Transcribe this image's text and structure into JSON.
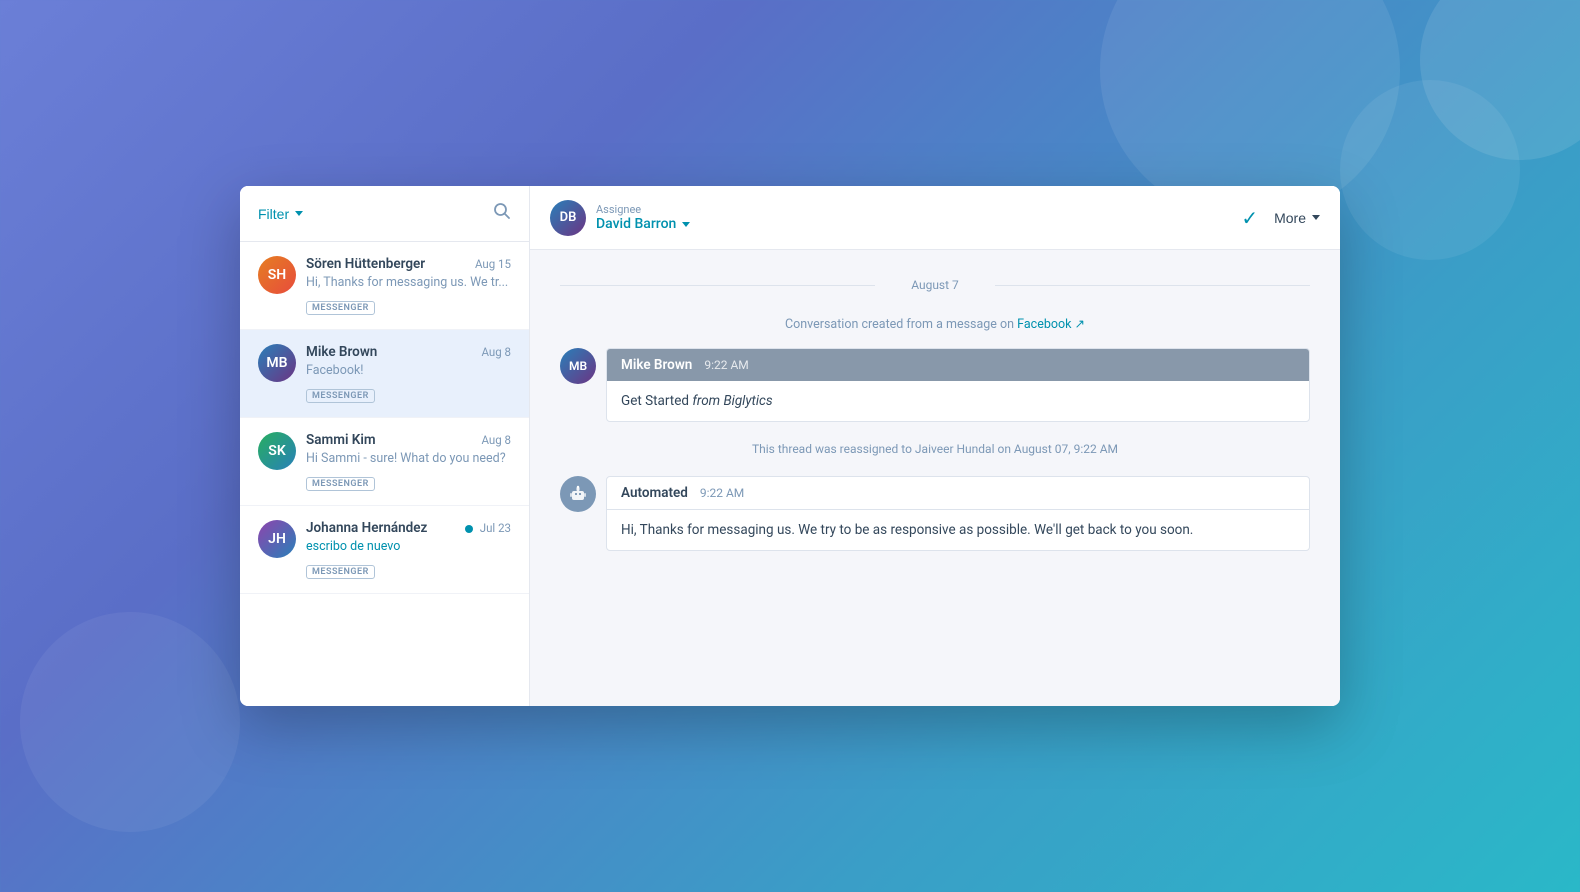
{
  "sidebar": {
    "filter_label": "Filter",
    "conversations": [
      {
        "id": "soren",
        "name": "Sören Hüttenberger",
        "date": "Aug 15",
        "preview": "Hi, Thanks for messaging us. We tr...",
        "badge": "MESSENGER",
        "active": false,
        "unread": false,
        "avatar_initials": "SH"
      },
      {
        "id": "mike",
        "name": "Mike Brown",
        "date": "Aug 8",
        "preview": "Facebook!",
        "badge": "MESSENGER",
        "active": true,
        "unread": false,
        "avatar_initials": "MB"
      },
      {
        "id": "sammi",
        "name": "Sammi Kim",
        "date": "Aug 8",
        "preview": "Hi Sammi - sure! What do you need?",
        "badge": "MESSENGER",
        "active": false,
        "unread": false,
        "avatar_initials": "SK"
      },
      {
        "id": "johanna",
        "name": "Johanna Hernández",
        "date": "Jul 23",
        "preview": "escribo de nuevo",
        "badge": "MESSENGER",
        "active": false,
        "unread": true,
        "avatar_initials": "JH"
      }
    ]
  },
  "header": {
    "assignee_label": "Assignee",
    "assignee_name": "David Barron",
    "more_label": "More",
    "check_label": "✓"
  },
  "chat": {
    "date_divider": "August 7",
    "system_message_pre": "Conversation created from a message on ",
    "system_message_link": "Facebook",
    "messages": [
      {
        "id": "msg1",
        "sender": "Mike Brown",
        "time": "9:22 AM",
        "body_text": "Get Started ",
        "body_em": "from Biglytics",
        "type": "user"
      }
    ],
    "reassign_notice": "This thread was reassigned to Jaiveer Hundal on August 07, 9:22 AM",
    "automated": {
      "sender": "Automated",
      "time": "9:22 AM",
      "body": "Hi,  Thanks for messaging us. We try to be as responsive as possible. We'll get back to you soon."
    }
  }
}
